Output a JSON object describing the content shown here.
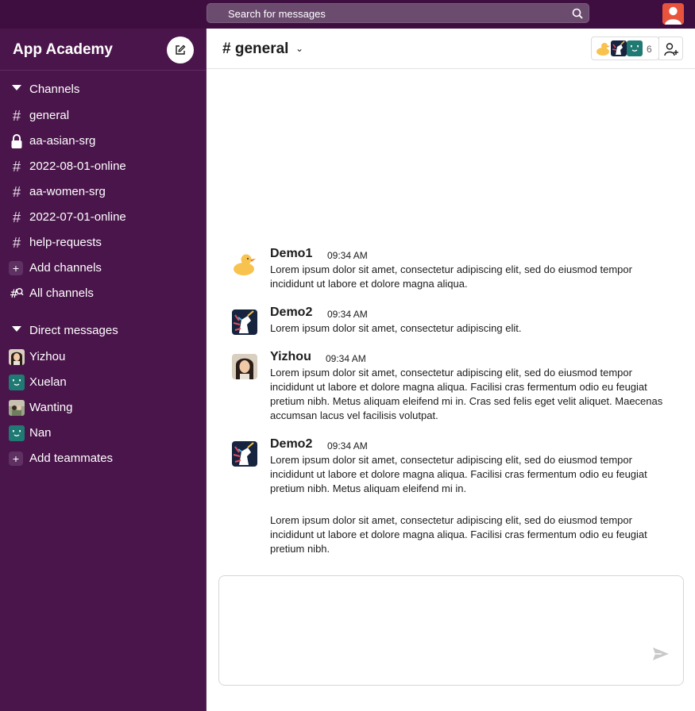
{
  "search": {
    "placeholder": "Search for messages"
  },
  "workspace": {
    "name": "App Academy"
  },
  "sidebar": {
    "channels_header": "Channels",
    "channels": [
      {
        "label": "general",
        "icon": "hash-icon"
      },
      {
        "label": "aa-asian-srg",
        "icon": "lock-icon"
      },
      {
        "label": "2022-08-01-online",
        "icon": "hash-icon"
      },
      {
        "label": "aa-women-srg",
        "icon": "hash-icon"
      },
      {
        "label": "2022-07-01-online",
        "icon": "hash-icon"
      },
      {
        "label": "help-requests",
        "icon": "hash-icon"
      }
    ],
    "add_channels": "Add channels",
    "all_channels": "All channels",
    "dm_header": "Direct messages",
    "dms": [
      {
        "label": "Yizhou",
        "avatar": "photo"
      },
      {
        "label": "Xuelan",
        "avatar": "teal-smile"
      },
      {
        "label": "Wanting",
        "avatar": "photo"
      },
      {
        "label": "Nan",
        "avatar": "teal-smile"
      }
    ],
    "add_teammates": "Add teammates"
  },
  "channel": {
    "title": "# general",
    "member_count": "6"
  },
  "messages": [
    {
      "name": "Demo1",
      "time": "09:34 AM",
      "avatar": "duck",
      "text": "Lorem ipsum dolor sit amet, consectetur adipiscing elit, sed do eiusmod tempor incididunt ut labore et dolore magna aliqua."
    },
    {
      "name": "Demo2",
      "time": "09:34 AM",
      "avatar": "unicorn",
      "text": "Lorem ipsum dolor sit amet, consectetur adipiscing elit."
    },
    {
      "name": "Yizhou",
      "time": "09:34 AM",
      "avatar": "photo",
      "text": "Lorem ipsum dolor sit amet, consectetur adipiscing elit, sed do eiusmod tempor incididunt ut labore et dolore magna aliqua. Facilisi cras fermentum odio eu feugiat pretium nibh. Metus aliquam eleifend mi in. Cras sed felis eget velit aliquet. Maecenas accumsan lacus vel facilisis volutpat."
    },
    {
      "name": "Demo2",
      "time": "09:34 AM",
      "avatar": "unicorn",
      "text": "Lorem ipsum dolor sit amet, consectetur adipiscing elit, sed do eiusmod tempor incididunt ut labore et dolore magna aliqua. Facilisi cras fermentum odio eu feugiat pretium nibh. Metus aliquam eleifend mi in.",
      "text2": "Lorem ipsum dolor sit amet, consectetur adipiscing elit, sed do eiusmod tempor incididunt ut labore et dolore magna aliqua. Facilisi cras fermentum odio eu feugiat pretium nibh."
    }
  ],
  "colors": {
    "topbar": "#3f0e40",
    "sidebar": "#4a154b",
    "accent_teal": "#1f7a73",
    "avatar_red": "#e8533c"
  }
}
